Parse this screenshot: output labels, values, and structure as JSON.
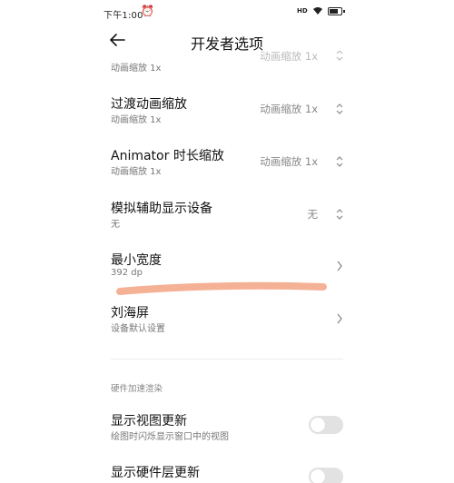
{
  "status_bar": {
    "time": "下午1:00",
    "alarm_icon": "alarm-clock-icon",
    "signal_text": "HD",
    "wifi_icon": "wifi-icon",
    "battery_icon": "battery-icon"
  },
  "header": {
    "back_icon": "back-arrow-icon",
    "title": "开发者选项"
  },
  "settings": [
    {
      "title": "",
      "subtitle": "动画缩放 1x",
      "value": "动画缩放 1x",
      "control": "updown"
    },
    {
      "title": "过渡动画缩放",
      "subtitle": "动画缩放 1x",
      "value": "动画缩放 1x",
      "control": "updown"
    },
    {
      "title": "Animator 时长缩放",
      "subtitle": "动画缩放 1x",
      "value": "动画缩放 1x",
      "control": "updown"
    },
    {
      "title": "模拟辅助显示设备",
      "subtitle": "无",
      "value": "无",
      "control": "updown"
    },
    {
      "title": "最小宽度",
      "subtitle": "392 dp",
      "value": "",
      "control": "chevron"
    },
    {
      "title": "刘海屏",
      "subtitle": "设备默认设置",
      "value": "",
      "control": "chevron"
    }
  ],
  "section": {
    "header": "硬件加速渲染",
    "items": [
      {
        "title": "显示视图更新",
        "subtitle": "绘图时闪烁显示窗口中的视图",
        "toggle_on": false
      },
      {
        "title": "显示硬件层更新",
        "subtitle": "",
        "toggle_on": false
      }
    ]
  },
  "colors": {
    "highlight_stroke": "#f4a88a",
    "toggle_off": "#e2e2e2"
  }
}
